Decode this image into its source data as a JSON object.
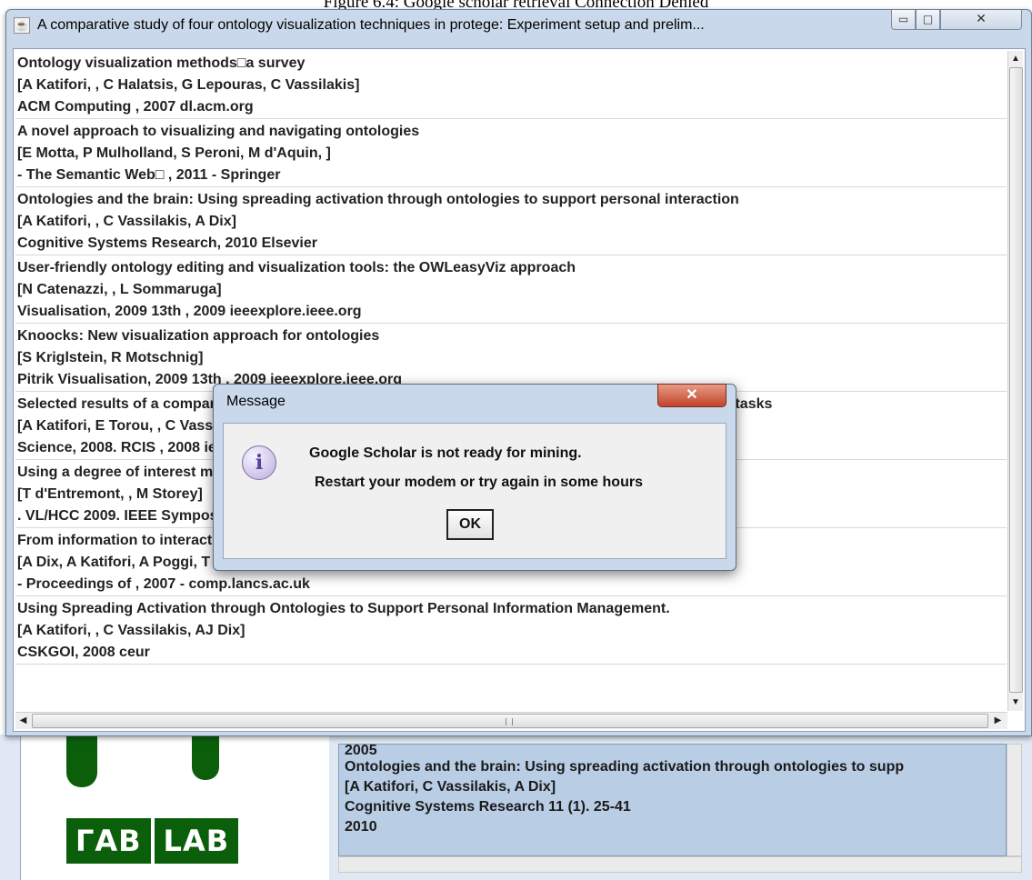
{
  "caption": "Figure 6.4: Google scholar retrieval Connection Denied",
  "window": {
    "title": "A comparative study of four ontology visualization techniques in protege: Experiment setup and prelim...",
    "icon": "java-icon",
    "minimize_glyph": "▭",
    "maximize_glyph": "□",
    "close_glyph": "✕"
  },
  "entries": [
    [
      "Ontology visualization methods□a survey",
      "[A Katifori, , C Halatsis, G Lepouras, C Vassilakis]",
      "ACM Computing , 2007 dl.acm.org"
    ],
    [
      "A novel approach to visualizing and navigating ontologies",
      "[E Motta, P Mulholland, S Peroni, M d'Aquin, ]",
      "- The Semantic Web□ , 2011 - Springer"
    ],
    [
      "Ontologies and the brain: Using spreading activation through ontologies to support personal interaction",
      "[A Katifori, , C Vassilakis, A Dix]",
      "Cognitive Systems Research, 2010 Elsevier"
    ],
    [
      "User-friendly ontology editing and visualization tools: the OWLeasyViz approach",
      "[N Catenazzi, , L Sommaruga]",
      "Visualisation, 2009 13th , 2009 ieeexplore.ieee.org"
    ],
    [
      "Knoocks: New visualization approach for ontologies",
      "[S Kriglstein, R Motschnig]",
      "Pitrik Visualisation, 2009 13th , 2009 ieeexplore.ieee.org"
    ],
    [
      "Selected results of a comparative study of four ontology visualization methods for information retrieval tasks",
      "[A Katifori, E Torou, , C Vassilakis, G Lepouras, C Halatsis]",
      "Science, 2008. RCIS , 2008 ieeexplore.ieee.org"
    ],
    [
      "Using a degree of interest model for adaptive visualizations",
      "[T d'Entremont, , M Storey]",
      ". VL/HCC 2009. IEEE Symposium on , 2009 ieeexplore.ieee.org"
    ],
    [
      "From information to interaction: in pursuit of task-centred information management",
      "[A Dix, A Katifori, A Poggi, T Catarci, ]",
      "- Proceedings of , 2007 - comp.lancs.ac.uk"
    ],
    [
      "Using Spreading Activation through Ontologies to Support Personal Information Management.",
      "[A Katifori, , C Vassilakis, AJ Dix]",
      "CSKGOI, 2008 ceur"
    ]
  ],
  "dialog": {
    "title": "Message",
    "close_glyph": "✕",
    "icon": "info-icon",
    "icon_glyph": "i",
    "line1": "Google Scholar is not ready for mining.",
    "line2": "Restart your modem or try again in some hours",
    "ok_label": "OK"
  },
  "background_app": {
    "logo_left": "ΓAB",
    "logo_right": "LAB",
    "list_rows": [
      "2005",
      "Ontologies and the brain: Using spreading activation through ontologies to supp",
      "[A Katifori, C Vassilakis, A Dix]",
      "Cognitive Systems Research 11 (1). 25-41",
      "2010"
    ]
  },
  "colors": {
    "window_frame": "#c9d8ea",
    "dialog_close": "#c1442a",
    "logo_green": "#0b5f0b",
    "bg_list": "#b9cde5"
  }
}
